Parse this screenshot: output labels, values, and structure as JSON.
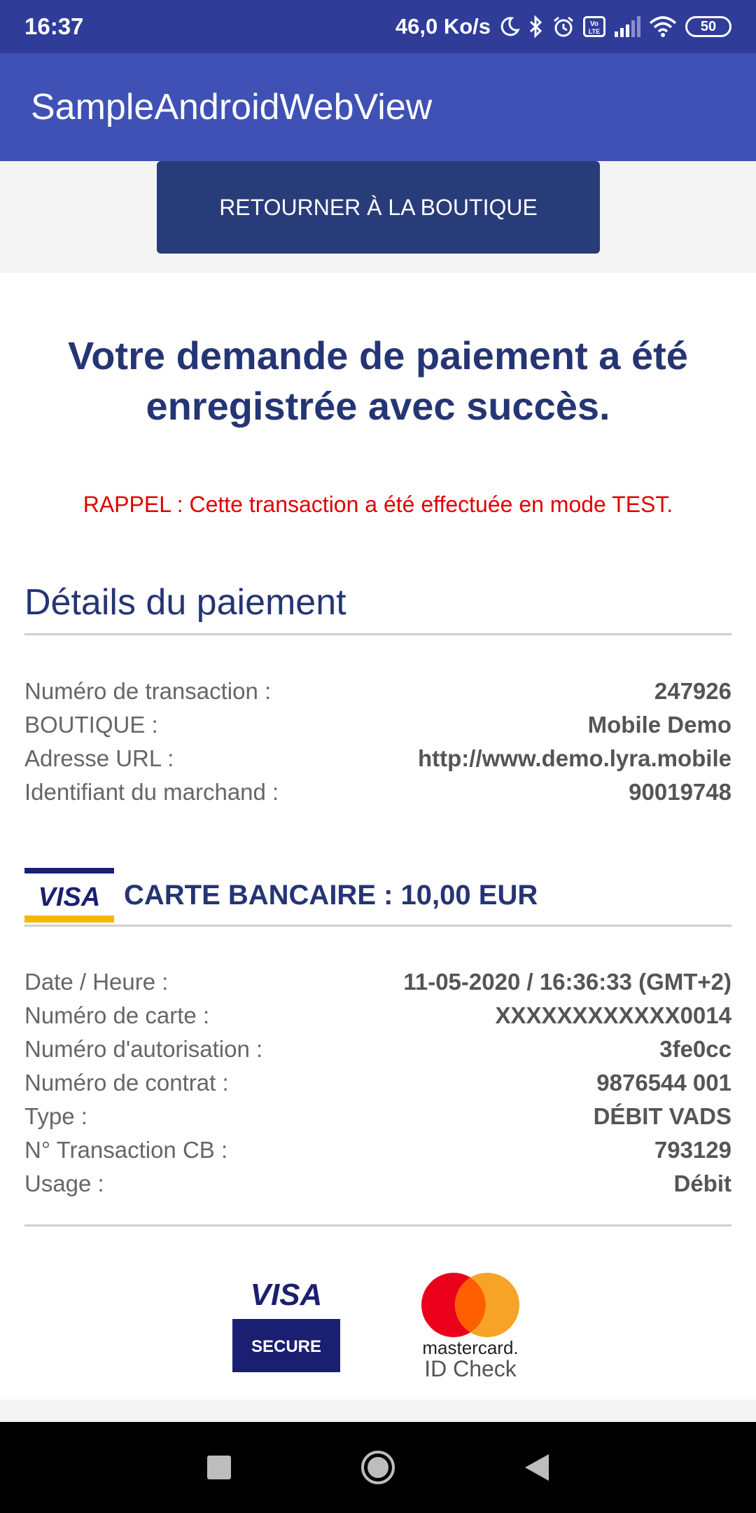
{
  "status_bar": {
    "time": "16:37",
    "speed": "46,0 Ko/s",
    "battery": "50",
    "icons": [
      "moon-icon",
      "bluetooth-icon",
      "alarm-icon",
      "volte-icon",
      "signal-icon",
      "wifi-icon",
      "battery-icon"
    ]
  },
  "app_bar": {
    "title": "SampleAndroidWebView"
  },
  "back_button": {
    "label": "RETOURNER À LA BOUTIQUE"
  },
  "headline": "Votre demande de paiement a été enregistrée avec succès.",
  "notice": "RAPPEL : Cette transaction a été effectuée en mode TEST.",
  "payment_details": {
    "title": "Détails du paiement",
    "rows": [
      {
        "label": "Numéro de transaction :",
        "value": "247926"
      },
      {
        "label": "BOUTIQUE :",
        "value": "Mobile Demo"
      },
      {
        "label": "Adresse URL :",
        "value": "http://www.demo.lyra.mobile"
      },
      {
        "label": "Identifiant du marchand :",
        "value": "90019748"
      }
    ]
  },
  "card": {
    "brand_logo": "VISA",
    "title": "CARTE BANCAIRE : 10,00 EUR",
    "rows": [
      {
        "label": "Date / Heure :",
        "value": "11-05-2020 / 16:36:33 (GMT+2)"
      },
      {
        "label": "Numéro de carte :",
        "value": "XXXXXXXXXXXX0014"
      },
      {
        "label": "Numéro d'autorisation :",
        "value": "3fe0cc"
      },
      {
        "label": "Numéro de contrat :",
        "value": "9876544 001"
      },
      {
        "label": "Type :",
        "value": "DÉBIT VADS"
      },
      {
        "label": "N° Transaction CB :",
        "value": "793129"
      },
      {
        "label": "Usage :",
        "value": "Débit"
      }
    ]
  },
  "security_logos": {
    "visa_secure_top": "VISA",
    "visa_secure_bottom": "SECURE",
    "mastercard_word": "mastercard.",
    "mastercard_sub": "ID Check"
  },
  "colors": {
    "status_bar": "#2f3d99",
    "app_bar": "#3f51b5",
    "button": "#293c7a",
    "heading": "#253574",
    "notice": "#e00000"
  }
}
